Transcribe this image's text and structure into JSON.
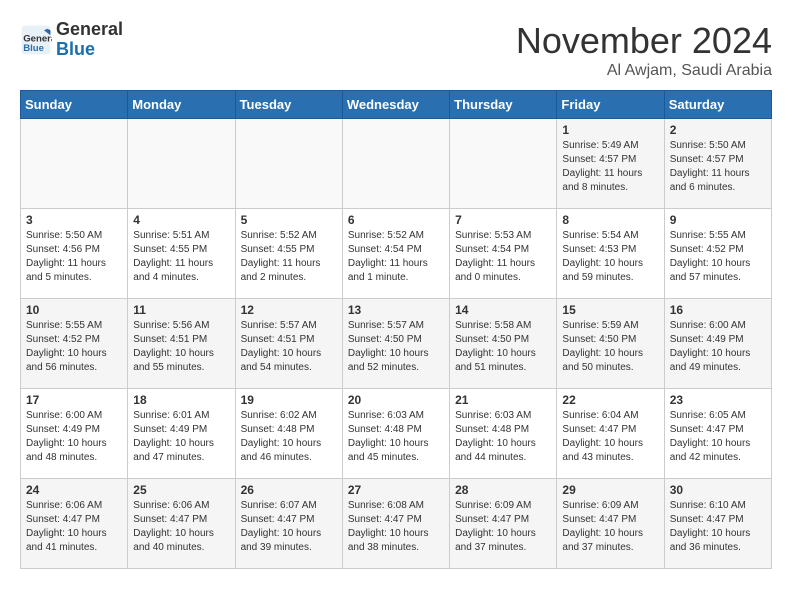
{
  "header": {
    "logo_line1": "General",
    "logo_line2": "Blue",
    "month": "November 2024",
    "location": "Al Awjam, Saudi Arabia"
  },
  "days_of_week": [
    "Sunday",
    "Monday",
    "Tuesday",
    "Wednesday",
    "Thursday",
    "Friday",
    "Saturday"
  ],
  "weeks": [
    [
      {
        "day": "",
        "info": ""
      },
      {
        "day": "",
        "info": ""
      },
      {
        "day": "",
        "info": ""
      },
      {
        "day": "",
        "info": ""
      },
      {
        "day": "",
        "info": ""
      },
      {
        "day": "1",
        "info": "Sunrise: 5:49 AM\nSunset: 4:57 PM\nDaylight: 11 hours\nand 8 minutes."
      },
      {
        "day": "2",
        "info": "Sunrise: 5:50 AM\nSunset: 4:57 PM\nDaylight: 11 hours\nand 6 minutes."
      }
    ],
    [
      {
        "day": "3",
        "info": "Sunrise: 5:50 AM\nSunset: 4:56 PM\nDaylight: 11 hours\nand 5 minutes."
      },
      {
        "day": "4",
        "info": "Sunrise: 5:51 AM\nSunset: 4:55 PM\nDaylight: 11 hours\nand 4 minutes."
      },
      {
        "day": "5",
        "info": "Sunrise: 5:52 AM\nSunset: 4:55 PM\nDaylight: 11 hours\nand 2 minutes."
      },
      {
        "day": "6",
        "info": "Sunrise: 5:52 AM\nSunset: 4:54 PM\nDaylight: 11 hours\nand 1 minute."
      },
      {
        "day": "7",
        "info": "Sunrise: 5:53 AM\nSunset: 4:54 PM\nDaylight: 11 hours\nand 0 minutes."
      },
      {
        "day": "8",
        "info": "Sunrise: 5:54 AM\nSunset: 4:53 PM\nDaylight: 10 hours\nand 59 minutes."
      },
      {
        "day": "9",
        "info": "Sunrise: 5:55 AM\nSunset: 4:52 PM\nDaylight: 10 hours\nand 57 minutes."
      }
    ],
    [
      {
        "day": "10",
        "info": "Sunrise: 5:55 AM\nSunset: 4:52 PM\nDaylight: 10 hours\nand 56 minutes."
      },
      {
        "day": "11",
        "info": "Sunrise: 5:56 AM\nSunset: 4:51 PM\nDaylight: 10 hours\nand 55 minutes."
      },
      {
        "day": "12",
        "info": "Sunrise: 5:57 AM\nSunset: 4:51 PM\nDaylight: 10 hours\nand 54 minutes."
      },
      {
        "day": "13",
        "info": "Sunrise: 5:57 AM\nSunset: 4:50 PM\nDaylight: 10 hours\nand 52 minutes."
      },
      {
        "day": "14",
        "info": "Sunrise: 5:58 AM\nSunset: 4:50 PM\nDaylight: 10 hours\nand 51 minutes."
      },
      {
        "day": "15",
        "info": "Sunrise: 5:59 AM\nSunset: 4:50 PM\nDaylight: 10 hours\nand 50 minutes."
      },
      {
        "day": "16",
        "info": "Sunrise: 6:00 AM\nSunset: 4:49 PM\nDaylight: 10 hours\nand 49 minutes."
      }
    ],
    [
      {
        "day": "17",
        "info": "Sunrise: 6:00 AM\nSunset: 4:49 PM\nDaylight: 10 hours\nand 48 minutes."
      },
      {
        "day": "18",
        "info": "Sunrise: 6:01 AM\nSunset: 4:49 PM\nDaylight: 10 hours\nand 47 minutes."
      },
      {
        "day": "19",
        "info": "Sunrise: 6:02 AM\nSunset: 4:48 PM\nDaylight: 10 hours\nand 46 minutes."
      },
      {
        "day": "20",
        "info": "Sunrise: 6:03 AM\nSunset: 4:48 PM\nDaylight: 10 hours\nand 45 minutes."
      },
      {
        "day": "21",
        "info": "Sunrise: 6:03 AM\nSunset: 4:48 PM\nDaylight: 10 hours\nand 44 minutes."
      },
      {
        "day": "22",
        "info": "Sunrise: 6:04 AM\nSunset: 4:47 PM\nDaylight: 10 hours\nand 43 minutes."
      },
      {
        "day": "23",
        "info": "Sunrise: 6:05 AM\nSunset: 4:47 PM\nDaylight: 10 hours\nand 42 minutes."
      }
    ],
    [
      {
        "day": "24",
        "info": "Sunrise: 6:06 AM\nSunset: 4:47 PM\nDaylight: 10 hours\nand 41 minutes."
      },
      {
        "day": "25",
        "info": "Sunrise: 6:06 AM\nSunset: 4:47 PM\nDaylight: 10 hours\nand 40 minutes."
      },
      {
        "day": "26",
        "info": "Sunrise: 6:07 AM\nSunset: 4:47 PM\nDaylight: 10 hours\nand 39 minutes."
      },
      {
        "day": "27",
        "info": "Sunrise: 6:08 AM\nSunset: 4:47 PM\nDaylight: 10 hours\nand 38 minutes."
      },
      {
        "day": "28",
        "info": "Sunrise: 6:09 AM\nSunset: 4:47 PM\nDaylight: 10 hours\nand 37 minutes."
      },
      {
        "day": "29",
        "info": "Sunrise: 6:09 AM\nSunset: 4:47 PM\nDaylight: 10 hours\nand 37 minutes."
      },
      {
        "day": "30",
        "info": "Sunrise: 6:10 AM\nSunset: 4:47 PM\nDaylight: 10 hours\nand 36 minutes."
      }
    ]
  ]
}
